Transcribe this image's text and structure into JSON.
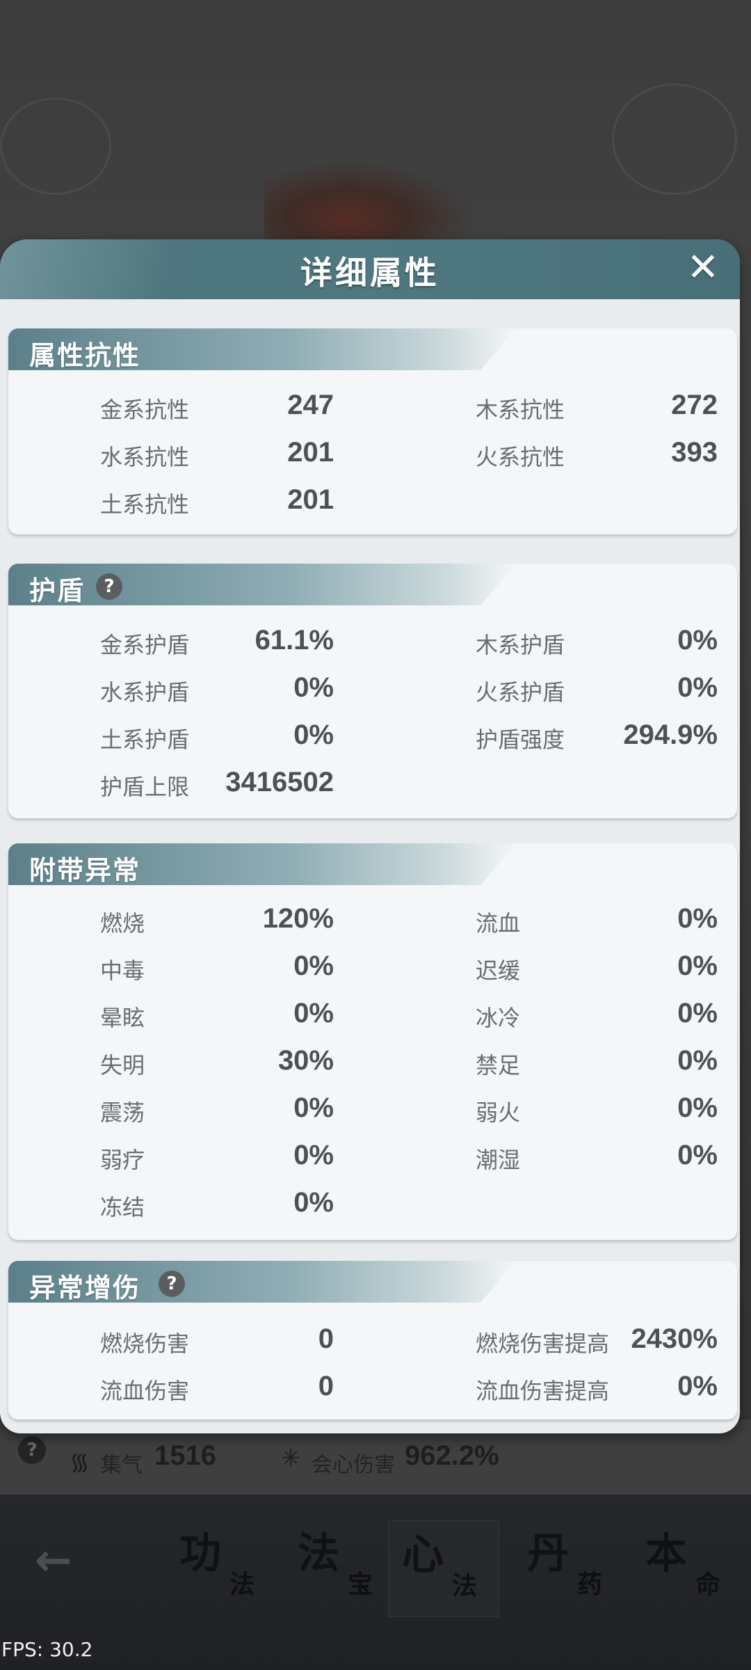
{
  "modal": {
    "title": "详细属性",
    "close_icon": "close-icon"
  },
  "sections": {
    "resistance": {
      "title": "属性抗性",
      "items": [
        {
          "label": "金系抗性",
          "value": "247"
        },
        {
          "label": "木系抗性",
          "value": "272"
        },
        {
          "label": "水系抗性",
          "value": "201"
        },
        {
          "label": "火系抗性",
          "value": "393"
        },
        {
          "label": "土系抗性",
          "value": "201"
        }
      ]
    },
    "shield": {
      "title": "护盾",
      "items": [
        {
          "label": "金系护盾",
          "value": "61.1%"
        },
        {
          "label": "木系护盾",
          "value": "0%"
        },
        {
          "label": "水系护盾",
          "value": "0%"
        },
        {
          "label": "火系护盾",
          "value": "0%"
        },
        {
          "label": "土系护盾",
          "value": "0%"
        },
        {
          "label": "护盾强度",
          "value": "294.9%"
        },
        {
          "label": "护盾上限",
          "value": "3416502"
        }
      ]
    },
    "abnormal": {
      "title": "附带异常",
      "items": [
        {
          "label": "燃烧",
          "value": "120%"
        },
        {
          "label": "流血",
          "value": "0%"
        },
        {
          "label": "中毒",
          "value": "0%"
        },
        {
          "label": "迟缓",
          "value": "0%"
        },
        {
          "label": "晕眩",
          "value": "0%"
        },
        {
          "label": "冰冷",
          "value": "0%"
        },
        {
          "label": "失明",
          "value": "30%"
        },
        {
          "label": "禁足",
          "value": "0%"
        },
        {
          "label": "震荡",
          "value": "0%"
        },
        {
          "label": "弱火",
          "value": "0%"
        },
        {
          "label": "弱疗",
          "value": "0%"
        },
        {
          "label": "潮湿",
          "value": "0%"
        },
        {
          "label": "冻结",
          "value": "0%"
        }
      ]
    },
    "abnormal_damage": {
      "title": "异常增伤",
      "items": [
        {
          "label": "燃烧伤害",
          "value": "0"
        },
        {
          "label": "燃烧伤害提高",
          "value": "2430%"
        },
        {
          "label": "流血伤害",
          "value": "0"
        },
        {
          "label": "流血伤害提高",
          "value": "0%"
        }
      ]
    }
  },
  "background": {
    "stat_qi_label": "集气",
    "stat_qi_value": "1516",
    "stat_crit_label": "会心伤害",
    "stat_crit_value": "962.2%",
    "help": "?"
  },
  "bottom_nav": {
    "back_icon": "arrow-left-icon",
    "tabs": [
      {
        "big": "功",
        "small": "法"
      },
      {
        "big": "法",
        "small": "宝"
      },
      {
        "big": "心",
        "small": "法",
        "active": true
      },
      {
        "big": "丹",
        "small": "药"
      },
      {
        "big": "本",
        "small": "命"
      }
    ]
  },
  "fps": "FPS: 30.2"
}
